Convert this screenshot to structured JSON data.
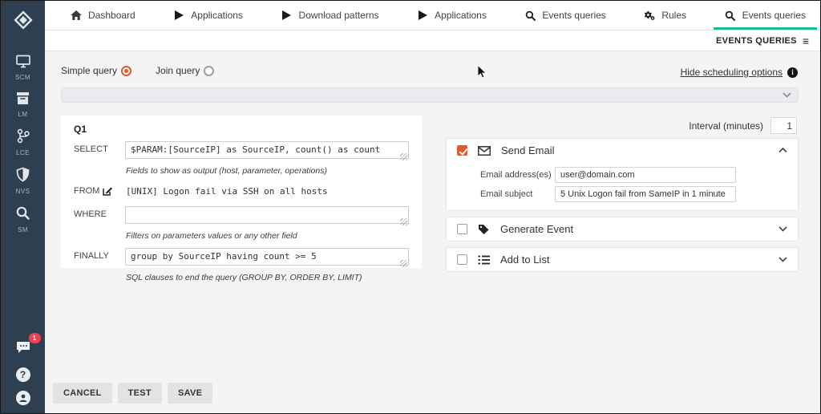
{
  "colors": {
    "accent_teal": "#1abc9c",
    "accent_orange": "#e8562d",
    "sidebar_bg": "#2e3f50",
    "badge_red": "#ef4056"
  },
  "sidebar": {
    "items": [
      {
        "label": "SCM",
        "icon": "monitor-icon"
      },
      {
        "label": "LM",
        "icon": "archive-box-icon"
      },
      {
        "label": "LCE",
        "icon": "git-branch-icon"
      },
      {
        "label": "NVS",
        "icon": "shield-icon"
      },
      {
        "label": "SM",
        "icon": "magnifier-icon"
      }
    ],
    "chat_badge": "1",
    "help_glyph": "?"
  },
  "topnav": {
    "items": [
      {
        "label": "Dashboard",
        "icon": "home"
      },
      {
        "label": "Applications",
        "icon": "play"
      },
      {
        "label": "Download patterns",
        "icon": "play"
      },
      {
        "label": "Applications",
        "icon": "play"
      },
      {
        "label": "Events queries",
        "icon": "search"
      },
      {
        "label": "Rules",
        "icon": "gear"
      },
      {
        "label": "Events queries",
        "icon": "search",
        "active": true
      }
    ]
  },
  "subheader": {
    "title": "EVENTS QUERIES",
    "menu_icon": "≡"
  },
  "query_type": {
    "options": [
      {
        "label": "Simple query",
        "selected": true
      },
      {
        "label": "Join query",
        "selected": false
      }
    ]
  },
  "scheduling": {
    "link": "Hide scheduling options"
  },
  "builder": {
    "title": "Q1",
    "rows": {
      "select": {
        "label": "SELECT",
        "value": "$PARAM:[SourceIP] as SourceIP, count() as count",
        "help": "Fields to show as output (host, parameter, operations)"
      },
      "from": {
        "label": "FROM",
        "value": "[UNIX] Logon fail via SSH on all hosts"
      },
      "where": {
        "label": "WHERE",
        "value": "",
        "help": "Filters on parameters values or any other field"
      },
      "finally": {
        "label": "FINALLY",
        "value": "group by SourceIP having count >= 5",
        "help": "SQL clauses to end the query (GROUP BY, ORDER BY, LIMIT)"
      }
    }
  },
  "interval": {
    "label": "Interval (minutes)",
    "value": "1"
  },
  "actions": [
    {
      "title": "Send Email",
      "checked": true,
      "expanded": true,
      "fields": [
        {
          "label": "Email address(es)",
          "value": "user@domain.com"
        },
        {
          "label": "Email subject",
          "value": "5 Unix Logon fail from SameIP in 1 minute"
        }
      ]
    },
    {
      "title": "Generate Event",
      "checked": false,
      "expanded": false
    },
    {
      "title": "Add to List",
      "checked": false,
      "expanded": false
    }
  ],
  "footer": {
    "buttons": [
      "CANCEL",
      "TEST",
      "SAVE"
    ]
  }
}
